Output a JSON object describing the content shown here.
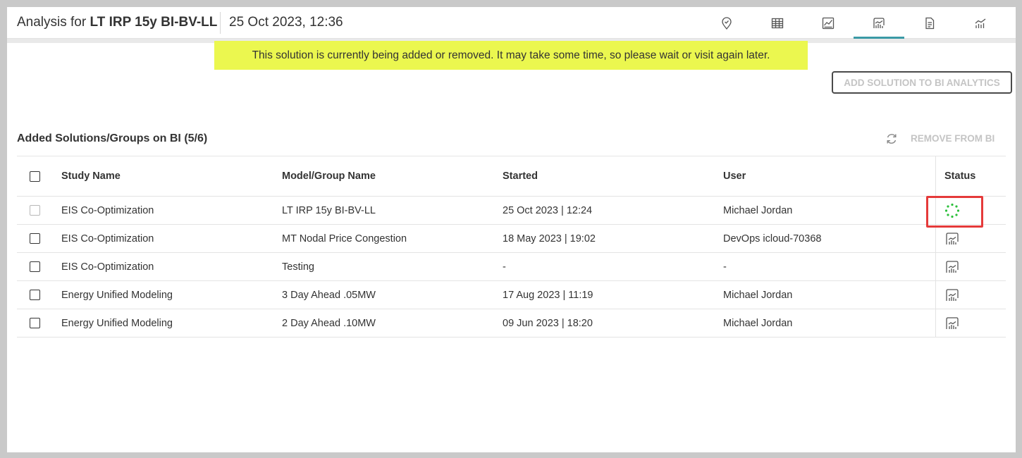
{
  "header": {
    "title_prefix": "Analysis for ",
    "title_name": "LT IRP 15y BI-BV-LL",
    "date": "25 Oct 2023, 12:36",
    "tabs": [
      {
        "icon": "location-pin-icon",
        "active": false
      },
      {
        "icon": "table-grid-icon",
        "active": false
      },
      {
        "icon": "line-chart-icon",
        "active": false
      },
      {
        "icon": "bi-analytics-icon",
        "active": true
      },
      {
        "icon": "document-icon",
        "active": false
      },
      {
        "icon": "trend-chart-icon",
        "active": false
      }
    ]
  },
  "notice": {
    "text": "This solution is currently being added or removed. It may take some time, so please wait or visit again later."
  },
  "actions": {
    "add_label": "ADD SOLUTION TO BI ANALYTICS",
    "remove_label": "REMOVE FROM BI"
  },
  "section": {
    "title": "Added Solutions/Groups on BI (5/6)"
  },
  "table": {
    "columns": [
      "Study Name",
      "Model/Group Name",
      "Started",
      "User",
      "Status"
    ],
    "rows": [
      {
        "study": "EIS Co-Optimization",
        "model": "LT IRP 15y BI-BV-LL",
        "started": "25 Oct 2023 | 12:24",
        "user": "Michael Jordan",
        "status": "loading"
      },
      {
        "study": "EIS Co-Optimization",
        "model": "MT Nodal Price Congestion",
        "started": "18 May 2023 | 19:02",
        "user": "DevOps icloud-70368",
        "status": "bi-analytics-icon"
      },
      {
        "study": "EIS Co-Optimization",
        "model": "Testing",
        "started": "-",
        "user": "-",
        "status": "bi-analytics-icon"
      },
      {
        "study": "Energy Unified Modeling",
        "model": "3 Day Ahead .05MW",
        "started": "17 Aug 2023 | 11:19",
        "user": "Michael Jordan",
        "status": "bi-analytics-icon"
      },
      {
        "study": "Energy Unified Modeling",
        "model": "2 Day Ahead .10MW",
        "started": "09 Jun 2023 | 18:20",
        "user": "Michael Jordan",
        "status": "bi-analytics-icon"
      }
    ]
  },
  "colors": {
    "accent": "#3a9aa6",
    "notice_bg": "#ebf74f",
    "spinner": "#2bbf3a",
    "highlight": "#e53a3a"
  }
}
